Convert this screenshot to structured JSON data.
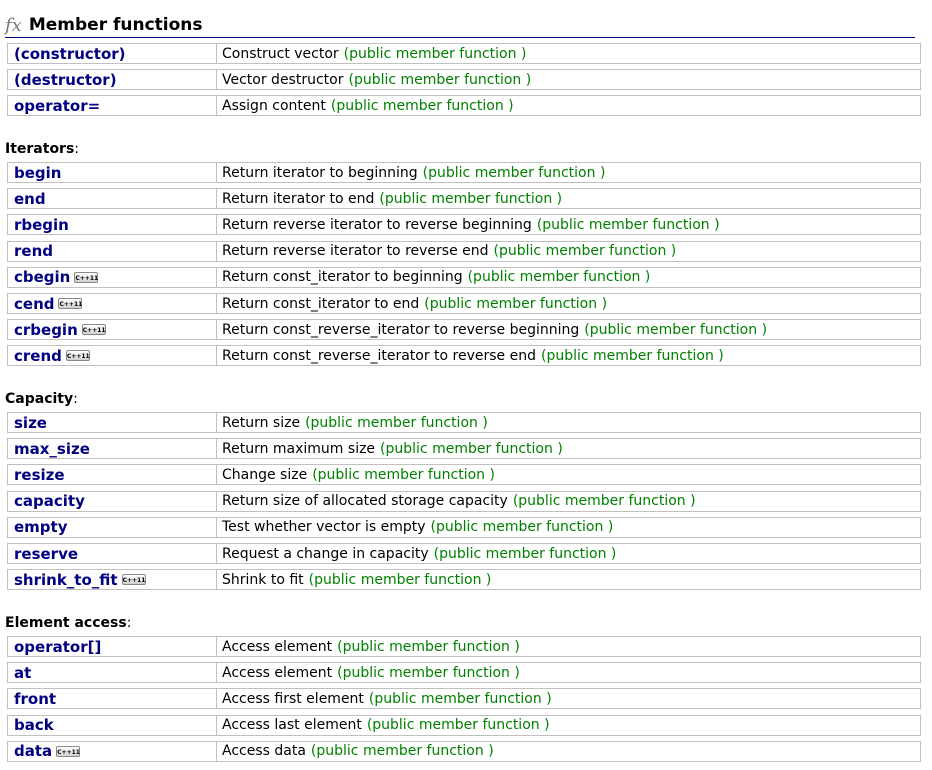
{
  "header": {
    "icon": "fx-icon",
    "title": "Member functions"
  },
  "kind_label": "(public member function )",
  "badge_label": "C++11",
  "groups": [
    {
      "label": "",
      "rows": [
        {
          "name": "(constructor)",
          "desc": "Construct vector",
          "kind": "(public member function )"
        },
        {
          "name": "(destructor)",
          "desc": "Vector destructor",
          "kind": "(public member function )"
        },
        {
          "name": "operator=",
          "desc": "Assign content",
          "kind": "(public member function )"
        }
      ]
    },
    {
      "label": "Iterators",
      "rows": [
        {
          "name": "begin",
          "desc": "Return iterator to beginning",
          "kind": "(public member function )"
        },
        {
          "name": "end",
          "desc": "Return iterator to end",
          "kind": "(public member function )"
        },
        {
          "name": "rbegin",
          "desc": "Return reverse iterator to reverse beginning",
          "kind": "(public member function )"
        },
        {
          "name": "rend",
          "desc": "Return reverse iterator to reverse end",
          "kind": "(public member function )"
        },
        {
          "name": "cbegin",
          "desc": "Return const_iterator to beginning",
          "kind": "(public member function )",
          "badge": "C++11"
        },
        {
          "name": "cend",
          "desc": "Return const_iterator to end",
          "kind": "(public member function )",
          "badge": "C++11"
        },
        {
          "name": "crbegin",
          "desc": "Return const_reverse_iterator to reverse beginning",
          "kind": "(public member function )",
          "badge": "C++11"
        },
        {
          "name": "crend",
          "desc": "Return const_reverse_iterator to reverse end",
          "kind": "(public member function )",
          "badge": "C++11"
        }
      ]
    },
    {
      "label": "Capacity",
      "rows": [
        {
          "name": "size",
          "desc": "Return size",
          "kind": "(public member function )"
        },
        {
          "name": "max_size",
          "desc": "Return maximum size",
          "kind": "(public member function )"
        },
        {
          "name": "resize",
          "desc": "Change size",
          "kind": "(public member function )"
        },
        {
          "name": "capacity",
          "desc": "Return size of allocated storage capacity",
          "kind": "(public member function )"
        },
        {
          "name": "empty",
          "desc": "Test whether vector is empty",
          "kind": "(public member function )"
        },
        {
          "name": "reserve",
          "desc": "Request a change in capacity",
          "kind": "(public member function )"
        },
        {
          "name": "shrink_to_fit",
          "desc": "Shrink to fit",
          "kind": "(public member function )",
          "badge": "C++11"
        }
      ]
    },
    {
      "label": "Element access",
      "rows": [
        {
          "name": "operator[]",
          "desc": "Access element",
          "kind": "(public member function )"
        },
        {
          "name": "at",
          "desc": "Access element",
          "kind": "(public member function )"
        },
        {
          "name": "front",
          "desc": "Access first element",
          "kind": "(public member function )"
        },
        {
          "name": "back",
          "desc": "Access last element",
          "kind": "(public member function )"
        },
        {
          "name": "data",
          "desc": "Access data",
          "kind": "(public member function )",
          "badge": "C++11"
        }
      ]
    }
  ],
  "colors": {
    "link": "#000080",
    "kind": "#008000",
    "border": "#c0c0c0",
    "rule": "#000080"
  }
}
